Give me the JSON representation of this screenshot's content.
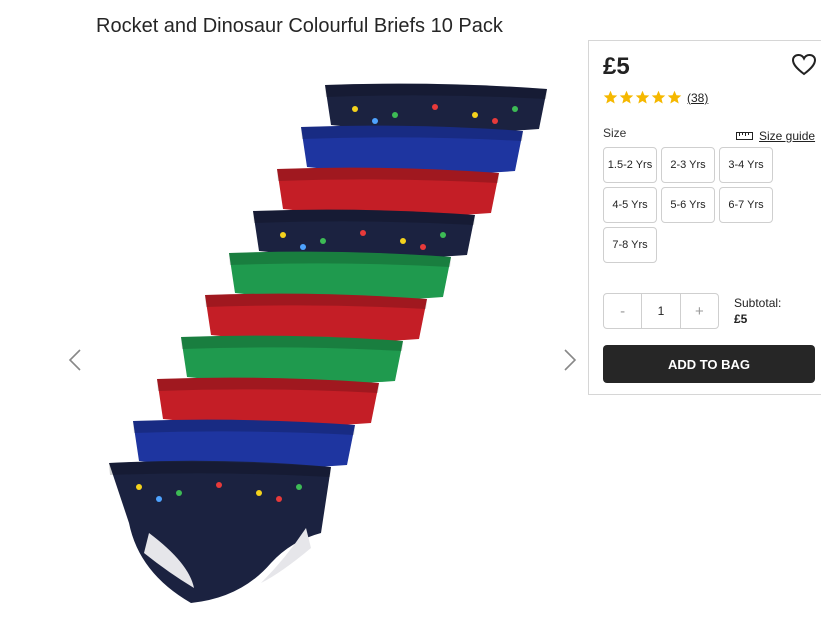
{
  "product": {
    "title": "Rocket and Dinosaur Colourful Briefs 10 Pack",
    "price": "£5",
    "rating": 5,
    "review_count": "(38)"
  },
  "gallery": {
    "image_alt": "Stack of ten colourful children's briefs with rocket and dinosaur prints",
    "brief_colors": [
      "#1b2240",
      "#1e35a0",
      "#c41e26",
      "#1b2240",
      "#1f9a4e",
      "#c41e26",
      "#1f9a4e",
      "#c41e26",
      "#1e35a0",
      "#1b2240"
    ]
  },
  "size": {
    "label": "Size",
    "guide_label": "Size guide",
    "options": [
      "1.5-2 Yrs",
      "2-3 Yrs",
      "3-4 Yrs",
      "4-5 Yrs",
      "5-6 Yrs",
      "6-7 Yrs",
      "7-8 Yrs"
    ]
  },
  "quantity": {
    "minus": "-",
    "value": "1",
    "plus": "+"
  },
  "subtotal": {
    "label": "Subtotal:",
    "amount": "£5"
  },
  "cart": {
    "add_label": "ADD TO BAG"
  },
  "colors": {
    "star": "#f5b800",
    "button_bg": "#262626"
  }
}
